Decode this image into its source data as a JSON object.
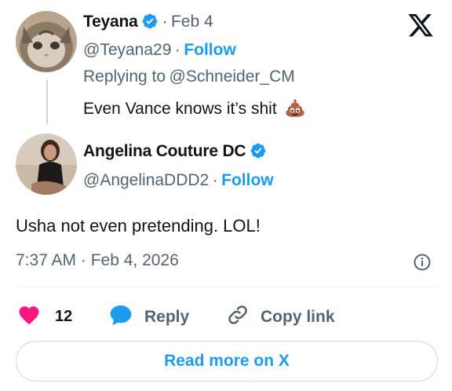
{
  "parent_tweet": {
    "display_name": "Teyana",
    "date_sep": "·",
    "date": "Feb 4",
    "handle": "@Teyana29",
    "follow_sep": "·",
    "follow_label": "Follow",
    "replying_to_prefix": "Replying to",
    "replying_to_handle": "@Schneider_CM",
    "text": "Even Vance knows it’s shit",
    "emoji_icon": "pile-of-poo-icon"
  },
  "main_tweet": {
    "display_name": "Angelina Couture DC",
    "handle": "@AngelinaDDD2",
    "follow_sep": "·",
    "follow_label": "Follow",
    "text": "Usha not even pretending. LOL!",
    "timestamp": "7:37 AM · Feb 4, 2026"
  },
  "actions": {
    "like_count": "12",
    "reply_label": "Reply",
    "copy_link_label": "Copy link"
  },
  "footer": {
    "read_more_label": "Read more on X"
  },
  "colors": {
    "accent": "#1d9bf0",
    "like": "#f91880",
    "muted": "#536471",
    "text": "#0f1419"
  },
  "icons": {
    "logo": "x-logo-icon",
    "verified": "verified-badge-icon",
    "info": "info-icon",
    "like": "heart-icon",
    "reply": "speech-bubble-icon",
    "copy_link": "link-icon"
  }
}
